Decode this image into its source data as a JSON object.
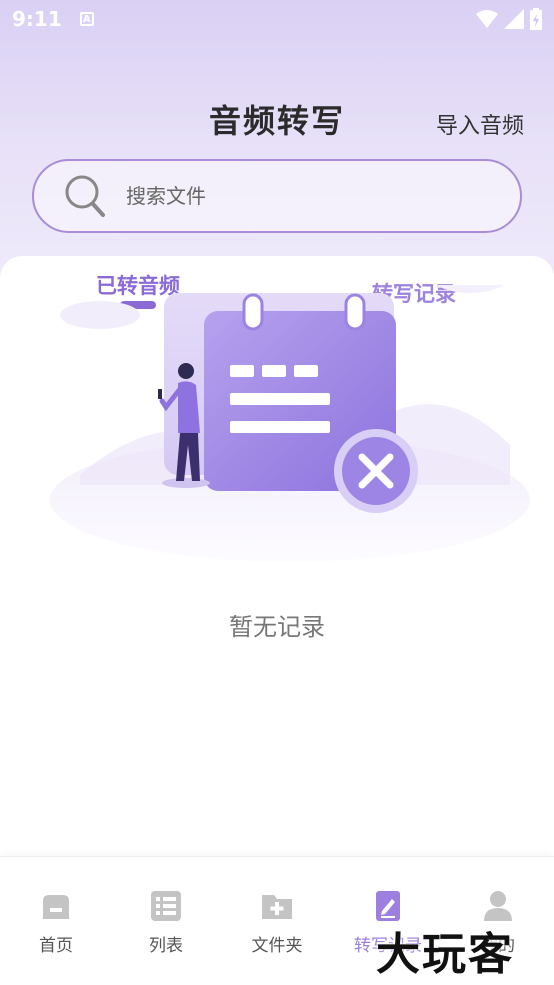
{
  "status_bar": {
    "time": "9:11",
    "notification_letter": "A"
  },
  "header": {
    "title": "音频转写",
    "import_label": "导入音频"
  },
  "search": {
    "placeholder": "搜索文件"
  },
  "tabs": [
    {
      "label": "已转音频",
      "active": true
    },
    {
      "label": "转写记录",
      "active": false
    }
  ],
  "empty_state": {
    "message": "暂无记录"
  },
  "bottom_nav": [
    {
      "label": "首页",
      "icon": "home-icon",
      "active": false
    },
    {
      "label": "列表",
      "icon": "list-icon",
      "active": false
    },
    {
      "label": "文件夹",
      "icon": "folder-add-icon",
      "active": false
    },
    {
      "label": "转写记录",
      "icon": "edit-doc-icon",
      "active": true
    },
    {
      "label": "我的",
      "icon": "user-icon",
      "active": false
    }
  ],
  "watermark": "大玩客",
  "colors": {
    "accent": "#8b6ad6",
    "nav_active": "#9d7fe0",
    "nav_inactive_icon": "#c4c4c4"
  }
}
